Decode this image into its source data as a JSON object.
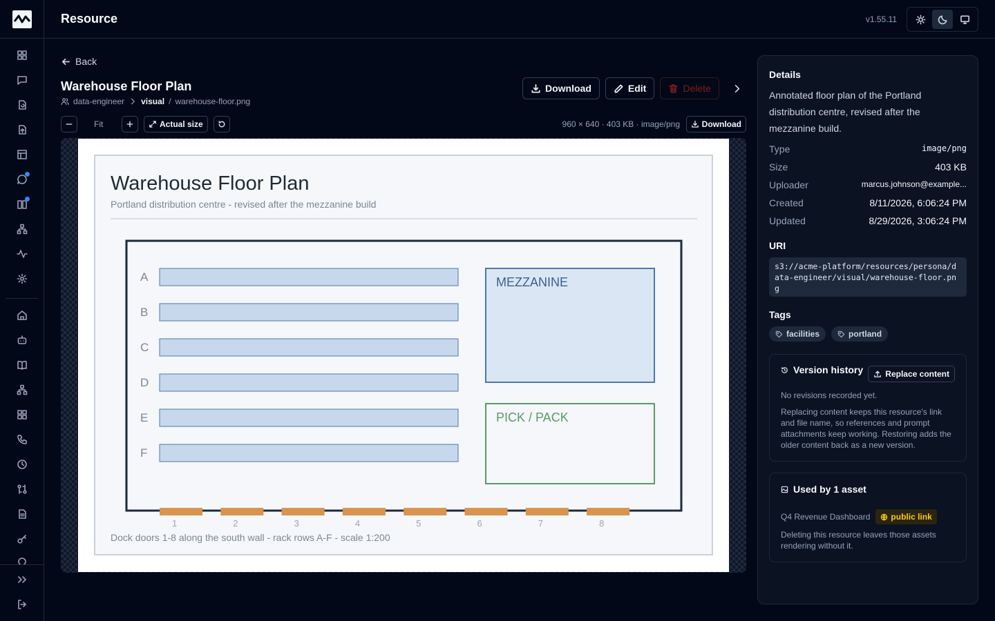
{
  "app": {
    "title": "Resource",
    "version": "v1.55.11"
  },
  "nav": {
    "back_label": "Back"
  },
  "resource": {
    "title": "Warehouse Floor Plan",
    "breadcrumb": {
      "persona": "data-engineer",
      "folder": "visual",
      "separator": "/",
      "file": "warehouse-floor.png"
    }
  },
  "actions": {
    "download": "Download",
    "edit": "Edit",
    "delete": "Delete"
  },
  "toolbar": {
    "fit": "Fit",
    "actual_size": "Actual size",
    "meta": "960 × 640 · 403 KB · image/png",
    "download": "Download"
  },
  "plan": {
    "title": "Warehouse Floor Plan",
    "subtitle": "Portland distribution centre - revised after the mezzanine build",
    "rows": [
      "A",
      "B",
      "C",
      "D",
      "E",
      "F"
    ],
    "zones": {
      "mezzanine": "MEZZANINE",
      "pick_pack": "PICK / PACK"
    },
    "doors": [
      "1",
      "2",
      "3",
      "4",
      "5",
      "6",
      "7",
      "8"
    ],
    "caption": "Dock doors 1-8 along the south wall - rack rows A-F - scale 1:200",
    "colors": {
      "rack_fill": "#c8d8ec",
      "rack_stroke": "#4a78b0",
      "mezz_fill": "#dbe6f4",
      "pick_stroke": "#5a9a68",
      "door": "#d9944f"
    }
  },
  "details": {
    "heading": "Details",
    "description": "Annotated floor plan of the Portland distribution centre, revised after the mezzanine build.",
    "fields": [
      {
        "key": "Type",
        "value": "image/png"
      },
      {
        "key": "Size",
        "value": "403 KB"
      },
      {
        "key": "Uploader",
        "value": "marcus.johnson@example..."
      },
      {
        "key": "Created",
        "value": "8/11/2026, 6:06:24 PM"
      },
      {
        "key": "Updated",
        "value": "8/29/2026, 3:06:24 PM"
      }
    ],
    "uri_heading": "URI",
    "uri": "s3://acme-platform/resources/persona/data-engineer/visual/warehouse-floor.png",
    "tags_heading": "Tags",
    "tags": [
      "facilities",
      "portland"
    ]
  },
  "version_history": {
    "title": "Version history",
    "replace_label": "Replace content",
    "empty": "No revisions recorded yet.",
    "note": "Replacing content keeps this resource's link and file name, so references and prompt attachments keep working. Restoring adds the older content back as a new version."
  },
  "used_by": {
    "title": "Used by 1 asset",
    "asset": "Q4 Revenue Dashboard",
    "badge": "public link",
    "note": "Deleting this resource leaves those assets rendering without it."
  },
  "theme": {
    "accent": "#3b82f6",
    "background": "#020817"
  }
}
